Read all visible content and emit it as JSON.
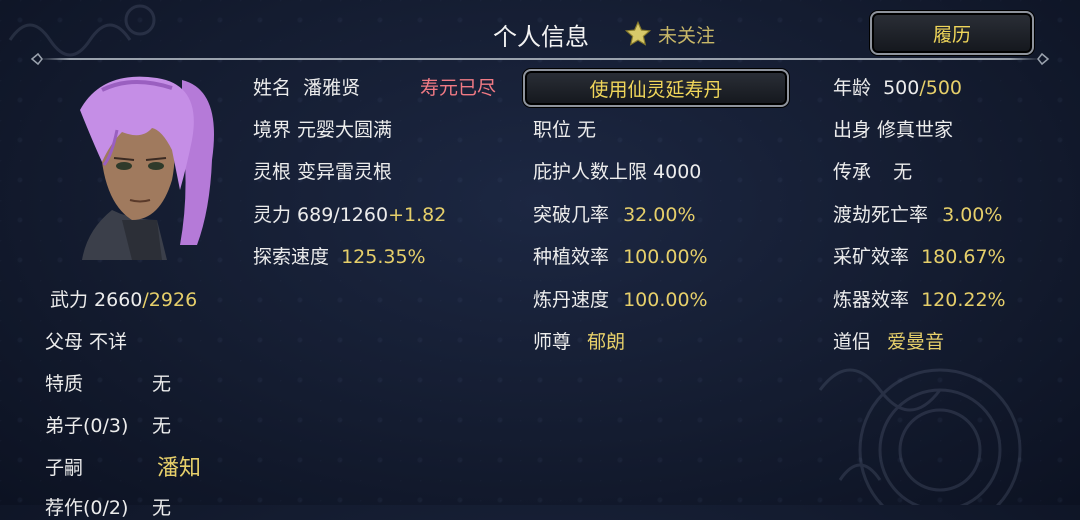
{
  "header": {
    "title": "个人信息",
    "follow_label": "未关注",
    "history_button": "履历"
  },
  "profile": {
    "name_label": "姓名",
    "name_value": "潘雅贤",
    "lifespan_status": "寿元已尽",
    "use_pill_button": "使用仙灵延寿丹",
    "age_label": "年龄",
    "age_current": "500",
    "age_max": "/500"
  },
  "stats": {
    "realm": "境界 元婴大圆满",
    "position": "职位 无",
    "origin": "出身 修真世家",
    "root": "灵根 变异雷灵根",
    "protect_limit": "庇护人数上限 4000",
    "inherit_label": "传承",
    "inherit_value": "无",
    "spirit_label": "灵力 689/1260",
    "spirit_bonus": "+1.82",
    "breakthrough_label": "突破几率",
    "breakthrough_value": "32.00%",
    "tribulation_label": "渡劫死亡率",
    "tribulation_value": "3.00%",
    "explore_label": "探索速度",
    "explore_value": "125.35%",
    "plant_label": "种植效率",
    "plant_value": "100.00%",
    "mining_label": "采矿效率",
    "mining_value": "180.67%",
    "force_label": "武力 2660",
    "force_max": "/2926",
    "alchemy_label": "炼丹速度",
    "alchemy_value": "100.00%",
    "forging_label": "炼器效率",
    "forging_value": "120.22%",
    "master_label": "师尊",
    "master_value": "郁朗",
    "partner_label": "道侣",
    "partner_value": "爱曼音"
  },
  "family": {
    "parents": "父母 不详",
    "trait_label": "特质",
    "trait_value": "无",
    "disciples_label": "弟子(0/3)",
    "disciples_value": "无",
    "heir_label": "子嗣",
    "heir_value": "潘知",
    "next_label": "荐作(0/2)",
    "next_value": "无"
  },
  "colors": {
    "accent_yellow": "#e6cf6a",
    "warning_red": "#f07a84",
    "background": "#141c30"
  }
}
